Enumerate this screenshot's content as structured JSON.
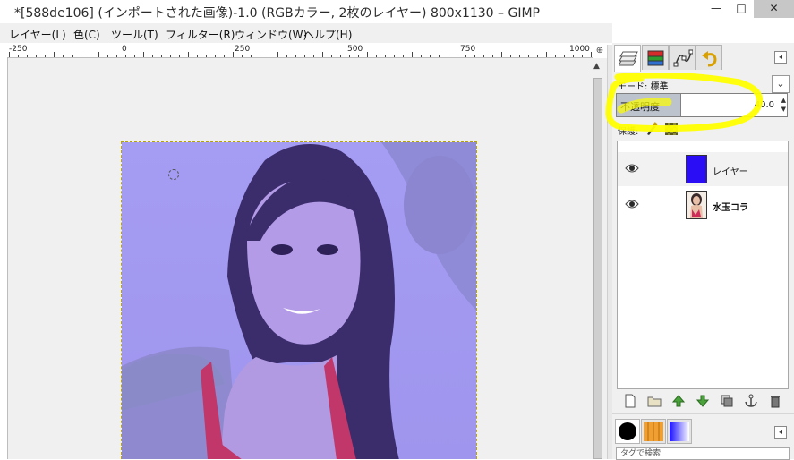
{
  "window": {
    "title": "*[588de106] (インポートされた画像)-1.0 (RGBカラー, 2枚のレイヤー) 800x1130 – GIMP",
    "minimize": "—",
    "maximize": "□",
    "close": "✕"
  },
  "menu": [
    {
      "label": "レイヤー(L)"
    },
    {
      "label": "色(C)"
    },
    {
      "label": "ツール(T)"
    },
    {
      "label": "フィルター(R)"
    },
    {
      "label": "ウィンドウ(W)"
    },
    {
      "label": "ヘルプ(H)"
    }
  ],
  "ruler": {
    "labels": [
      "-250",
      "0",
      "250",
      "500",
      "750",
      "1000"
    ]
  },
  "layers_panel": {
    "mode_label": "モード: 標準",
    "opacity_label": "不透明度",
    "opacity_value": "40.0",
    "opacity_fraction": 0.4,
    "lock_label": "保護:",
    "layers": [
      {
        "name": "レイヤー",
        "thumb": "solid-blue",
        "color": "#2a0cf5",
        "visible": true,
        "selected": true
      },
      {
        "name": "水玉コラ",
        "thumb": "photo",
        "visible": true,
        "selected": false
      }
    ],
    "tag_search_placeholder": "タグで検索"
  },
  "colors": {
    "overlay_tint": "#7b6cff",
    "highlight": "#ffff00",
    "layer_blue": "#2a0cf5",
    "selection_border": "#b8a400"
  },
  "icons": {
    "tabs": [
      "layers-icon",
      "channels-icon",
      "paths-icon",
      "undo-history-icon"
    ],
    "layer_buttons": [
      "new-layer-icon",
      "new-layer-group-icon",
      "raise-layer-icon",
      "lower-layer-icon",
      "duplicate-layer-icon",
      "anchor-layer-icon",
      "delete-layer-icon"
    ],
    "brush_tabs": [
      "brushes-icon",
      "patterns-icon",
      "gradients-icon"
    ]
  }
}
